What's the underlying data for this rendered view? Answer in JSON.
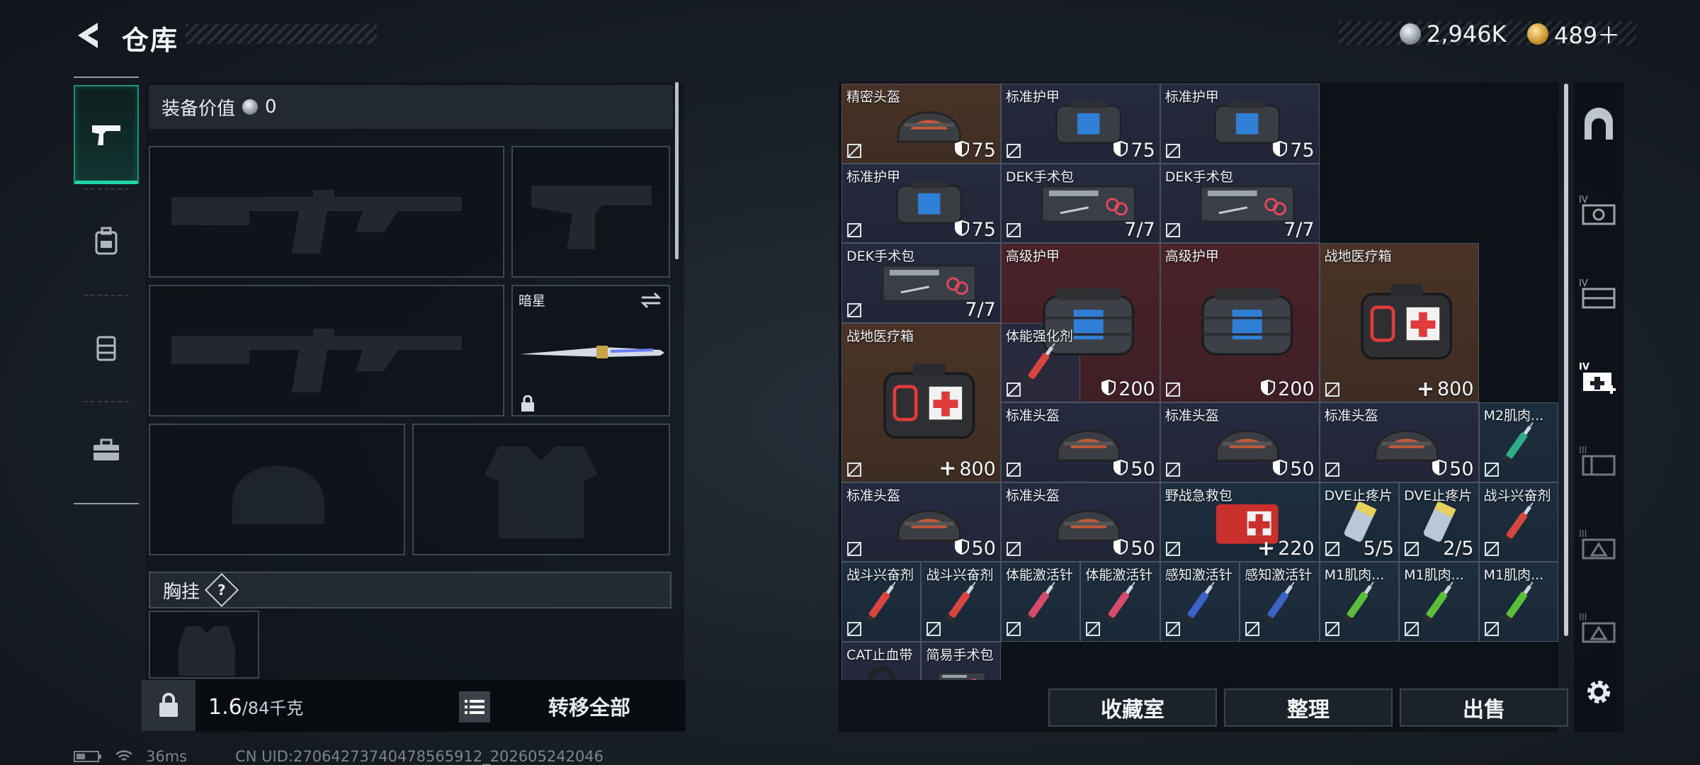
{
  "header": {
    "title": "仓库"
  },
  "currency": {
    "silver": "2,946K",
    "gold": "489＋"
  },
  "equipment": {
    "label": "装备价值",
    "value": "0"
  },
  "slots": {
    "knife_label": "暗星"
  },
  "chest_rig": {
    "label": "胸挂",
    "help": "?"
  },
  "bottom_left": {
    "weight": "1.6",
    "weight_cap": "/84千克",
    "transfer_all": "转移全部"
  },
  "actions": {
    "collection": "收藏室",
    "sort": "整理",
    "sell": "出售"
  },
  "status": {
    "ping": "36ms",
    "uid": "CN UID:2706427374047856591​2_202605242046"
  },
  "left_tabs": [
    "pistol-icon",
    "backpack-icon",
    "vest-icon",
    "toolbox-icon"
  ],
  "items": [
    {
      "name": "精密头盔",
      "value": "75",
      "icon": "shield",
      "art": "helmet"
    },
    {
      "name": "标准护甲",
      "value": "75",
      "icon": "shield",
      "art": "armor"
    },
    {
      "name": "标准护甲",
      "value": "75",
      "icon": "shield",
      "art": "armor"
    },
    {
      "name": "标准护甲",
      "value": "75",
      "icon": "shield",
      "art": "armor"
    },
    {
      "name": "DEK手术包",
      "value": "7/7",
      "icon": "",
      "art": "surgery"
    },
    {
      "name": "DEK手术包",
      "value": "7/7",
      "icon": "",
      "art": "surgery"
    },
    {
      "name": "DEK手术包",
      "value": "7/7",
      "icon": "",
      "art": "surgery"
    },
    {
      "name": "高级护甲",
      "value": "200",
      "icon": "shield",
      "art": "bigarmor"
    },
    {
      "name": "高级护甲",
      "value": "200",
      "icon": "shield",
      "art": "bigarmor"
    },
    {
      "name": "战地医疗箱",
      "value": "800",
      "icon": "plus",
      "art": "medkit"
    },
    {
      "name": "战地医疗箱",
      "value": "800",
      "icon": "plus",
      "art": "medkit"
    },
    {
      "name": "体能强化剂",
      "value": "",
      "icon": "",
      "art": "syringe-red"
    },
    {
      "name": "标准头盔",
      "value": "50",
      "icon": "shield",
      "art": "helmet"
    },
    {
      "name": "标准头盔",
      "value": "50",
      "icon": "shield",
      "art": "helmet"
    },
    {
      "name": "标准头盔",
      "value": "50",
      "icon": "shield",
      "art": "helmet"
    },
    {
      "name": "M2肌肉...",
      "value": "",
      "icon": "",
      "art": "syringe-teal"
    },
    {
      "name": "标准头盔",
      "value": "50",
      "icon": "shield",
      "art": "helmet"
    },
    {
      "name": "标准头盔",
      "value": "50",
      "icon": "shield",
      "art": "helmet"
    },
    {
      "name": "野战急救包",
      "value": "220",
      "icon": "plus",
      "art": "firstaid"
    },
    {
      "name": "DVE止疼片",
      "value": "5/5",
      "icon": "",
      "art": "pills"
    },
    {
      "name": "DVE止疼片",
      "value": "2/5",
      "icon": "",
      "art": "pills"
    },
    {
      "name": "战斗兴奋剂",
      "value": "",
      "icon": "",
      "art": "syringe-red"
    },
    {
      "name": "战斗兴奋剂",
      "value": "",
      "icon": "",
      "art": "syringe-red"
    },
    {
      "name": "战斗兴奋剂",
      "value": "",
      "icon": "",
      "art": "syringe-red"
    },
    {
      "name": "体能激活针",
      "value": "",
      "icon": "",
      "art": "syringe-pink"
    },
    {
      "name": "体能激活针",
      "value": "",
      "icon": "",
      "art": "syringe-pink"
    },
    {
      "name": "感知激活针",
      "value": "",
      "icon": "",
      "art": "syringe-blue"
    },
    {
      "name": "感知激活针",
      "value": "",
      "icon": "",
      "art": "syringe-blue"
    },
    {
      "name": "M1肌肉...",
      "value": "",
      "icon": "",
      "art": "syringe-green"
    },
    {
      "name": "M1肌肉...",
      "value": "",
      "icon": "",
      "art": "syringe-green"
    },
    {
      "name": "M1肌肉...",
      "value": "",
      "icon": "",
      "art": "syringe-green"
    },
    {
      "name": "CAT止血带",
      "value": "",
      "icon": "",
      "art": "tourniquet"
    },
    {
      "name": "简易手术包",
      "value": "",
      "icon": "",
      "art": "surgery"
    }
  ],
  "colors": {
    "accent": "#1fd4a9",
    "rarity_orange": "#4a3326",
    "rarity_purple": "#262a3e",
    "rarity_red": "#4a2228",
    "rarity_blue": "#1d2e3e"
  }
}
